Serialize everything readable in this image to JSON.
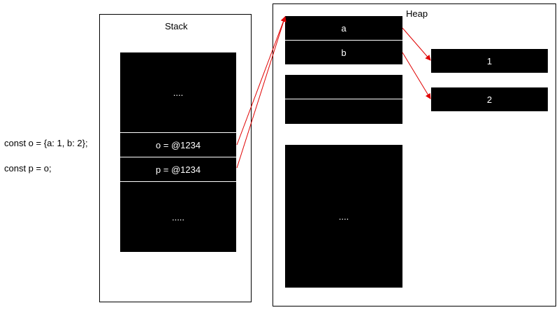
{
  "code": {
    "line1": "const o = {a: 1, b: 2};",
    "line2": "const p = o;"
  },
  "stack": {
    "title": "Stack",
    "top_ellipsis": "....",
    "slot_o": "o = @1234",
    "slot_p": "p = @1234",
    "bottom_ellipsis": "....."
  },
  "heap": {
    "title": "Heap",
    "field_a": "a",
    "field_b": "b",
    "value_1": "1",
    "value_2": "2",
    "ellipsis": "...."
  },
  "colors": {
    "arrow": "#e00000",
    "block": "#000000",
    "block_text": "#ffffff"
  }
}
